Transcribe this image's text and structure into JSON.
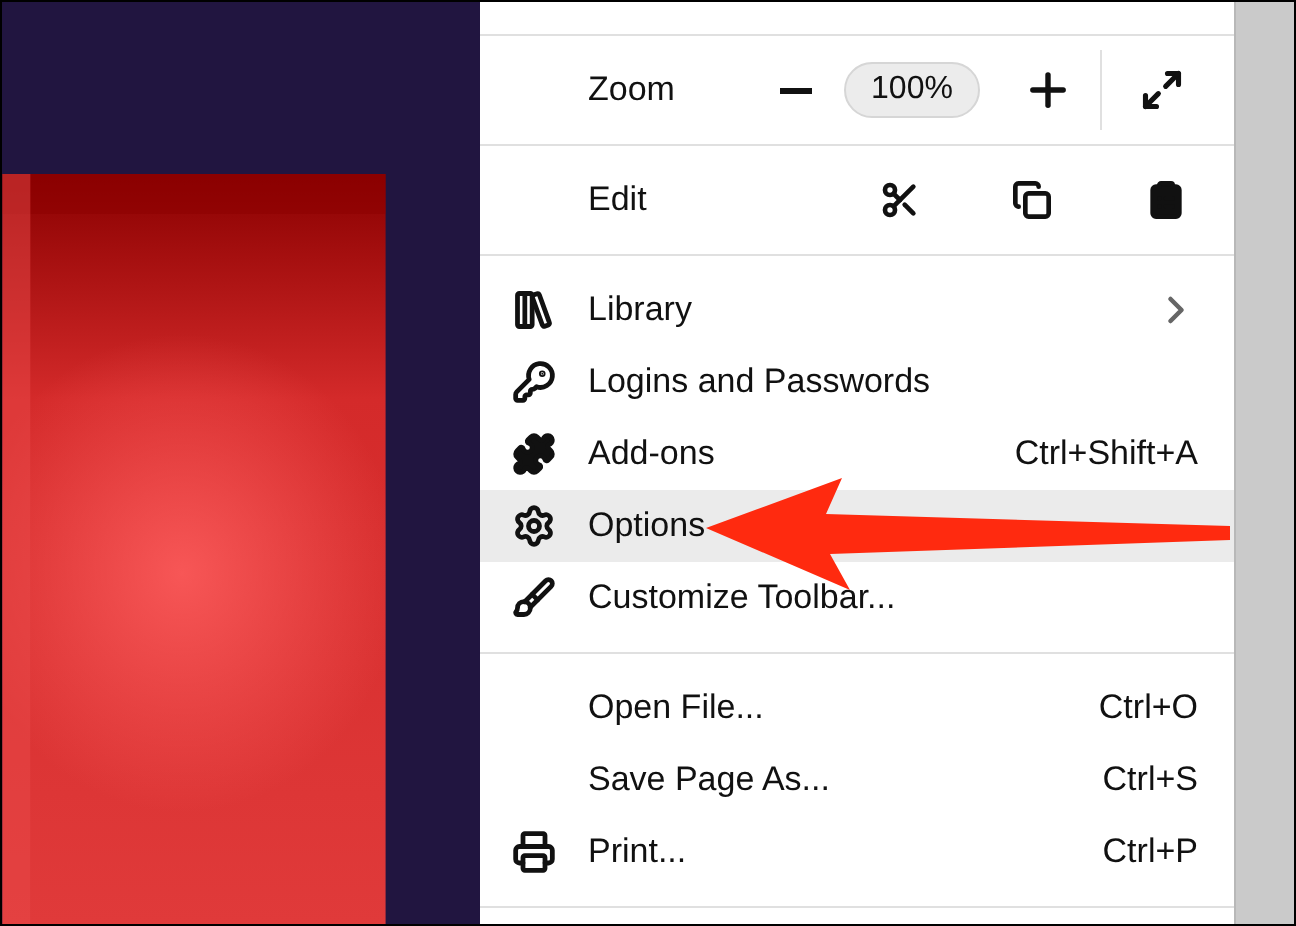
{
  "zoom": {
    "label": "Zoom",
    "value": "100%"
  },
  "edit": {
    "label": "Edit"
  },
  "menu_sections": [
    [
      {
        "label": "Library",
        "submenu": true,
        "selected": false
      },
      {
        "label": "Logins and Passwords",
        "submenu": false,
        "selected": false
      },
      {
        "label": "Add-ons",
        "shortcut": "Ctrl+Shift+A",
        "submenu": false,
        "selected": false
      },
      {
        "label": "Options",
        "submenu": false,
        "selected": true
      },
      {
        "label": "Customize Toolbar...",
        "submenu": false,
        "selected": false
      }
    ],
    [
      {
        "label": "Open File...",
        "shortcut": "Ctrl+O",
        "submenu": false,
        "selected": false
      },
      {
        "label": "Save Page As...",
        "shortcut": "Ctrl+S",
        "submenu": false,
        "selected": false
      },
      {
        "label": "Print...",
        "shortcut": "Ctrl+P",
        "submenu": false,
        "selected": false
      }
    ]
  ]
}
